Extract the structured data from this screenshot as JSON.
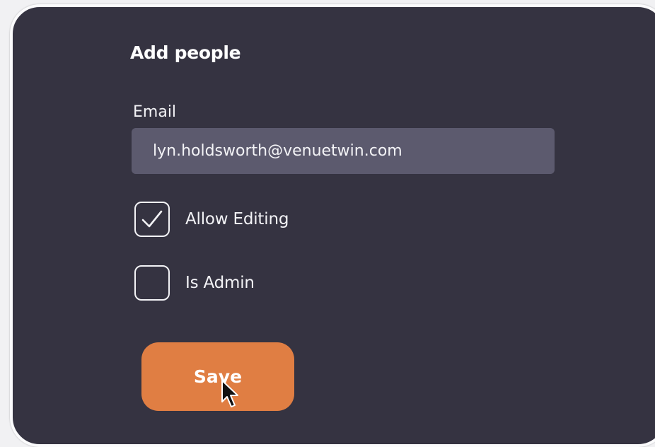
{
  "dialog": {
    "title": "Add people",
    "email": {
      "label": "Email",
      "value": "lyn.holdsworth@venuetwin.com",
      "placeholder": ""
    },
    "options": [
      {
        "label": "Allow Editing",
        "checked": true
      },
      {
        "label": "Is Admin",
        "checked": false
      }
    ],
    "save_label": "Save"
  },
  "colors": {
    "dialog_background": "#353341",
    "input_background": "#5c5a6e",
    "accent": "#e07e43",
    "text": "#f3f3f6"
  },
  "icons": {
    "checkbox_checked": "check-icon",
    "cursor": "mouse-pointer-icon"
  }
}
